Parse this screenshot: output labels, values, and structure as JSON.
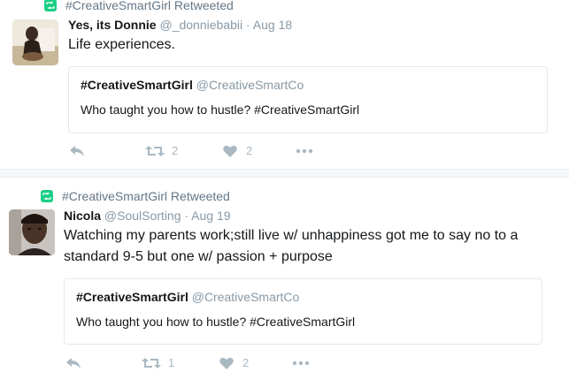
{
  "tweets": [
    {
      "retweet_label": "#CreativeSmartGirl Retweeted",
      "name": "Yes, its Donnie",
      "handle": "@_donniebabii",
      "date": "· Aug 18",
      "text": "Life experiences.",
      "quote": {
        "name": "#CreativeSmartGirl",
        "handle": "@CreativeSmartCo",
        "text": "Who taught you how to hustle? #CreativeSmartGirl"
      },
      "retweets": "2",
      "likes": "2"
    },
    {
      "retweet_label": "#CreativeSmartGirl Retweeted",
      "name": "Nicola",
      "handle": "@SoulSorting",
      "date": "· Aug 19",
      "text": "Watching my parents work;still live w/ unhappiness got me to say no to a standard 9-5 but one w/ passion + purpose",
      "quote": {
        "name": "#CreativeSmartGirl",
        "handle": "@CreativeSmartCo",
        "text": "Who taught you how to hustle? #CreativeSmartGirl"
      },
      "retweets": "1",
      "likes": "2"
    }
  ],
  "colors": {
    "retweet_icon": "#19cf86",
    "muted": "#8899a6",
    "action_icon": "#aab8c2"
  }
}
